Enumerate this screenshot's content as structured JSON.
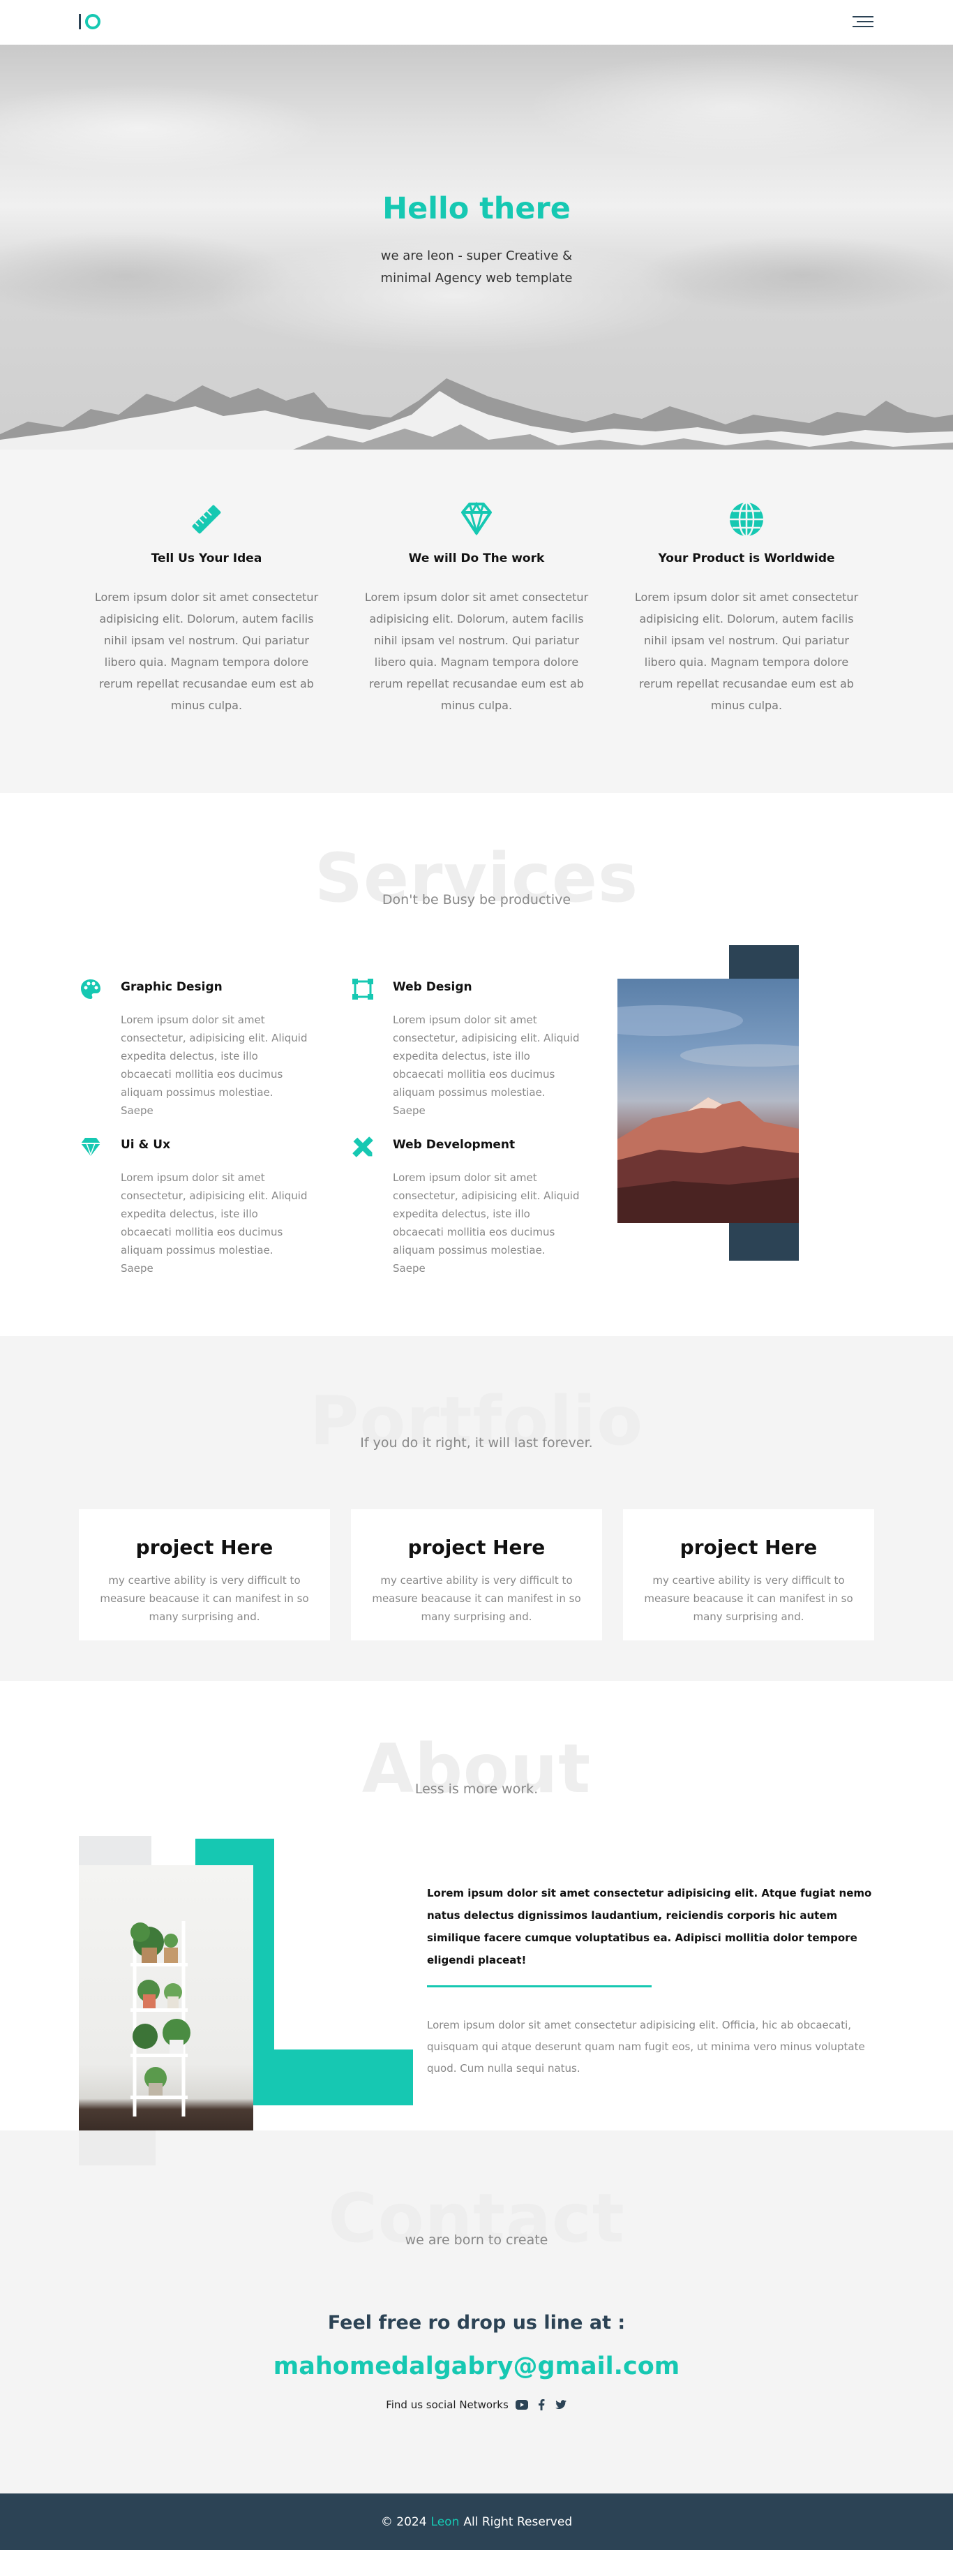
{
  "header": {
    "logo_icon": "io-logo-icon",
    "menu_icon": "hamburger-menu-icon"
  },
  "hero": {
    "title": "Hello there",
    "subtitle": "we are leon - super Creative & minimal Agency web template"
  },
  "features": [
    {
      "icon": "ruler-pencil-icon",
      "title": "Tell Us Your Idea",
      "text": "Lorem ipsum dolor sit amet consectetur adipisicing elit. Dolorum, autem facilis nihil ipsam vel nostrum. Qui pariatur libero quia. Magnam tempora dolore rerum repellat recusandae eum est ab minus culpa."
    },
    {
      "icon": "diamond-icon",
      "title": "We will Do The work",
      "text": "Lorem ipsum dolor sit amet consectetur adipisicing elit. Dolorum, autem facilis nihil ipsam vel nostrum. Qui pariatur libero quia. Magnam tempora dolore rerum repellat recusandae eum est ab minus culpa."
    },
    {
      "icon": "globe-icon",
      "title": "Your Product is Worldwide",
      "text": "Lorem ipsum dolor sit amet consectetur adipisicing elit. Dolorum, autem facilis nihil ipsam vel nostrum. Qui pariatur libero quia. Magnam tempora dolore rerum repellat recusandae eum est ab minus culpa."
    }
  ],
  "services": {
    "bg_title": "Services",
    "subtitle": "Don't be Busy be productive",
    "items": [
      {
        "icon": "palette-icon",
        "title": "Graphic Design",
        "text": "Lorem ipsum dolor sit amet consectetur, adipisicing elit. Aliquid expedita delectus, iste illo obcaecati mollitia eos ducimus aliquam possimus molestiae. Saepe"
      },
      {
        "icon": "vector-square-icon",
        "title": "Web Design",
        "text": "Lorem ipsum dolor sit amet consectetur, adipisicing elit. Aliquid expedita delectus, iste illo obcaecati mollitia eos ducimus aliquam possimus molestiae. Saepe"
      },
      {
        "icon": "diamond-icon",
        "title": "Ui & Ux",
        "text": "Lorem ipsum dolor sit amet consectetur, adipisicing elit. Aliquid expedita delectus, iste illo obcaecati mollitia eos ducimus aliquam possimus molestiae. Saepe"
      },
      {
        "icon": "pencil-ruler-icon",
        "title": "Web Development",
        "text": "Lorem ipsum dolor sit amet consectetur, adipisicing elit. Aliquid expedita delectus, iste illo obcaecati mollitia eos ducimus aliquam possimus molestiae. Saepe"
      }
    ]
  },
  "portfolio": {
    "bg_title": "Portfolio",
    "subtitle": "If you do it right, it will last forever.",
    "cards": [
      {
        "title": "project Here",
        "text": "my ceartive ability is very difficult to measure beacause it can manifest in so many surprising and."
      },
      {
        "title": "project Here",
        "text": "my ceartive ability is very difficult to measure beacause it can manifest in so many surprising and."
      },
      {
        "title": "project Here",
        "text": "my ceartive ability is very difficult to measure beacause it can manifest in so many surprising and."
      }
    ]
  },
  "about": {
    "bg_title": "About",
    "subtitle": "Less is more work.",
    "bold_text": "Lorem ipsum dolor sit amet consectetur adipisicing elit. Atque fugiat nemo natus delectus dignissimos laudantium, reiciendis corporis hic autem similique facere cumque voluptatibus ea. Adipisci mollitia dolor tempore eligendi placeat!",
    "text": "Lorem ipsum dolor sit amet consectetur adipisicing elit. Officia, hic ab obcaecati, quisquam qui atque deserunt quam nam fugit eos, ut minima vero minus voluptate quod. Cum nulla sequi natus."
  },
  "contact": {
    "bg_title": "Contact",
    "subtitle": "we are born to create",
    "line": "Feel free ro drop us line at :",
    "email": "mahomedalgabry@gmail.com",
    "social_label": "Find us social Networks",
    "social_icons": [
      "youtube-icon",
      "facebook-icon",
      "twitter-icon"
    ]
  },
  "footer": {
    "prefix": "© 2024",
    "brand": "Leon",
    "suffix": "All Right Reserved"
  },
  "colors": {
    "accent": "#16c8b2",
    "dark": "#2c4355"
  }
}
